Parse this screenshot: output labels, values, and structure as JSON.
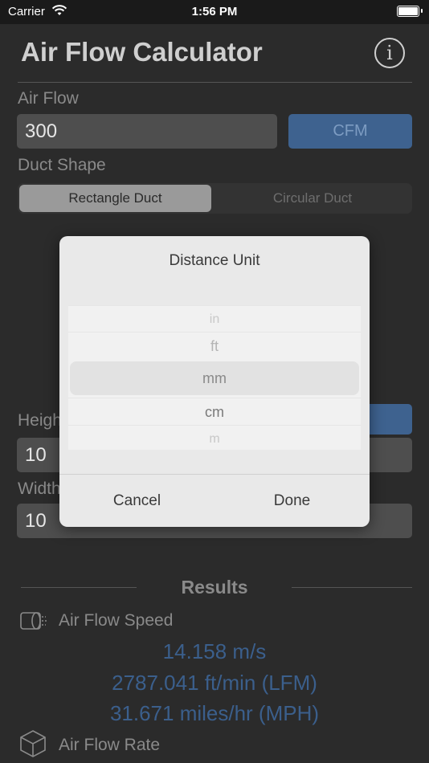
{
  "status_bar": {
    "carrier": "Carrier",
    "time": "1:56 PM"
  },
  "app": {
    "title": "Air Flow Calculator",
    "info_glyph": "i"
  },
  "air_flow": {
    "label": "Air Flow",
    "value": "300",
    "unit": "CFM"
  },
  "duct_shape": {
    "label": "Duct Shape",
    "options": [
      "Rectangle Duct",
      "Circular Duct"
    ],
    "selected": "Rectangle Duct"
  },
  "height": {
    "label": "Height",
    "value": "10"
  },
  "width": {
    "label": "Width",
    "value": "10"
  },
  "results": {
    "title": "Results",
    "speed_label": "Air Flow Speed",
    "speed_values": [
      "14.158 m/s",
      "2787.041 ft/min (LFM)",
      "31.671 miles/hr (MPH)"
    ],
    "rate_label": "Air Flow Rate"
  },
  "dialog": {
    "title": "Distance Unit",
    "options": [
      "in",
      "ft",
      "mm",
      "cm",
      "m"
    ],
    "selected": "mm",
    "cancel": "Cancel",
    "done": "Done"
  },
  "colors": {
    "accent": "#3e628f",
    "result_text": "#3b5f8c"
  }
}
